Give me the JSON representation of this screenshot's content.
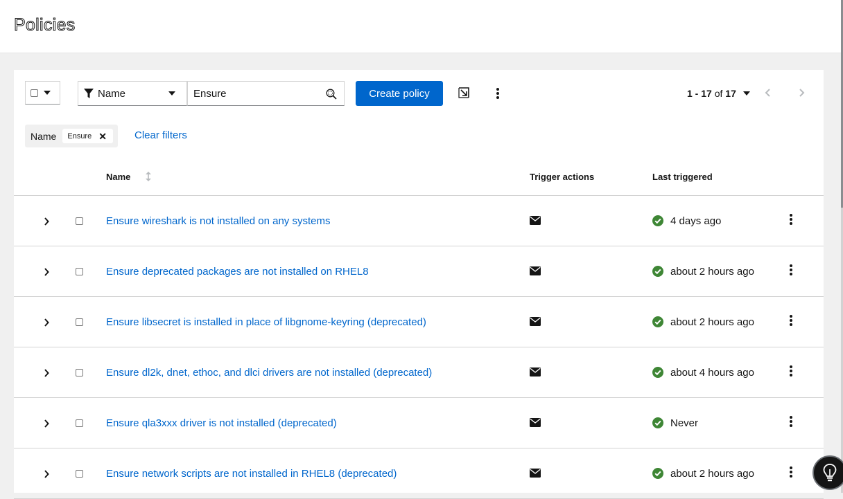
{
  "page": {
    "title": "Policies"
  },
  "toolbar": {
    "filter_attribute": "Name",
    "search_value": "Ensure",
    "create_label": "Create policy",
    "pagination": {
      "range": "1 - 17",
      "of": "of",
      "total": "17"
    }
  },
  "chips": {
    "category": "Name",
    "value": "Ensure",
    "clear_label": "Clear filters"
  },
  "table": {
    "headers": {
      "name": "Name",
      "trigger": "Trigger actions",
      "last": "Last triggered"
    },
    "rows": [
      {
        "name": "Ensure wireshark is not installed on any systems",
        "last": "4 days ago"
      },
      {
        "name": "Ensure deprecated packages are not installed on RHEL8",
        "last": "about 2 hours ago"
      },
      {
        "name": "Ensure libsecret is installed in place of libgnome-keyring (deprecated)",
        "last": "about 2 hours ago"
      },
      {
        "name": "Ensure dl2k, dnet, ethoc, and dlci drivers are not installed (deprecated)",
        "last": "about 4 hours ago"
      },
      {
        "name": "Ensure qla3xxx driver is not installed (deprecated)",
        "last": "Never"
      },
      {
        "name": "Ensure network scripts are not installed in RHEL8 (deprecated)",
        "last": "about 2 hours ago"
      }
    ]
  },
  "colors": {
    "primary": "#0066cc",
    "success": "#3e8635",
    "text": "#151515"
  },
  "icons": [
    "filter-icon",
    "search-icon",
    "export-icon",
    "kebab-icon",
    "envelope-icon",
    "check-circle-icon",
    "chevron-right-icon",
    "lightbulb-icon"
  ]
}
